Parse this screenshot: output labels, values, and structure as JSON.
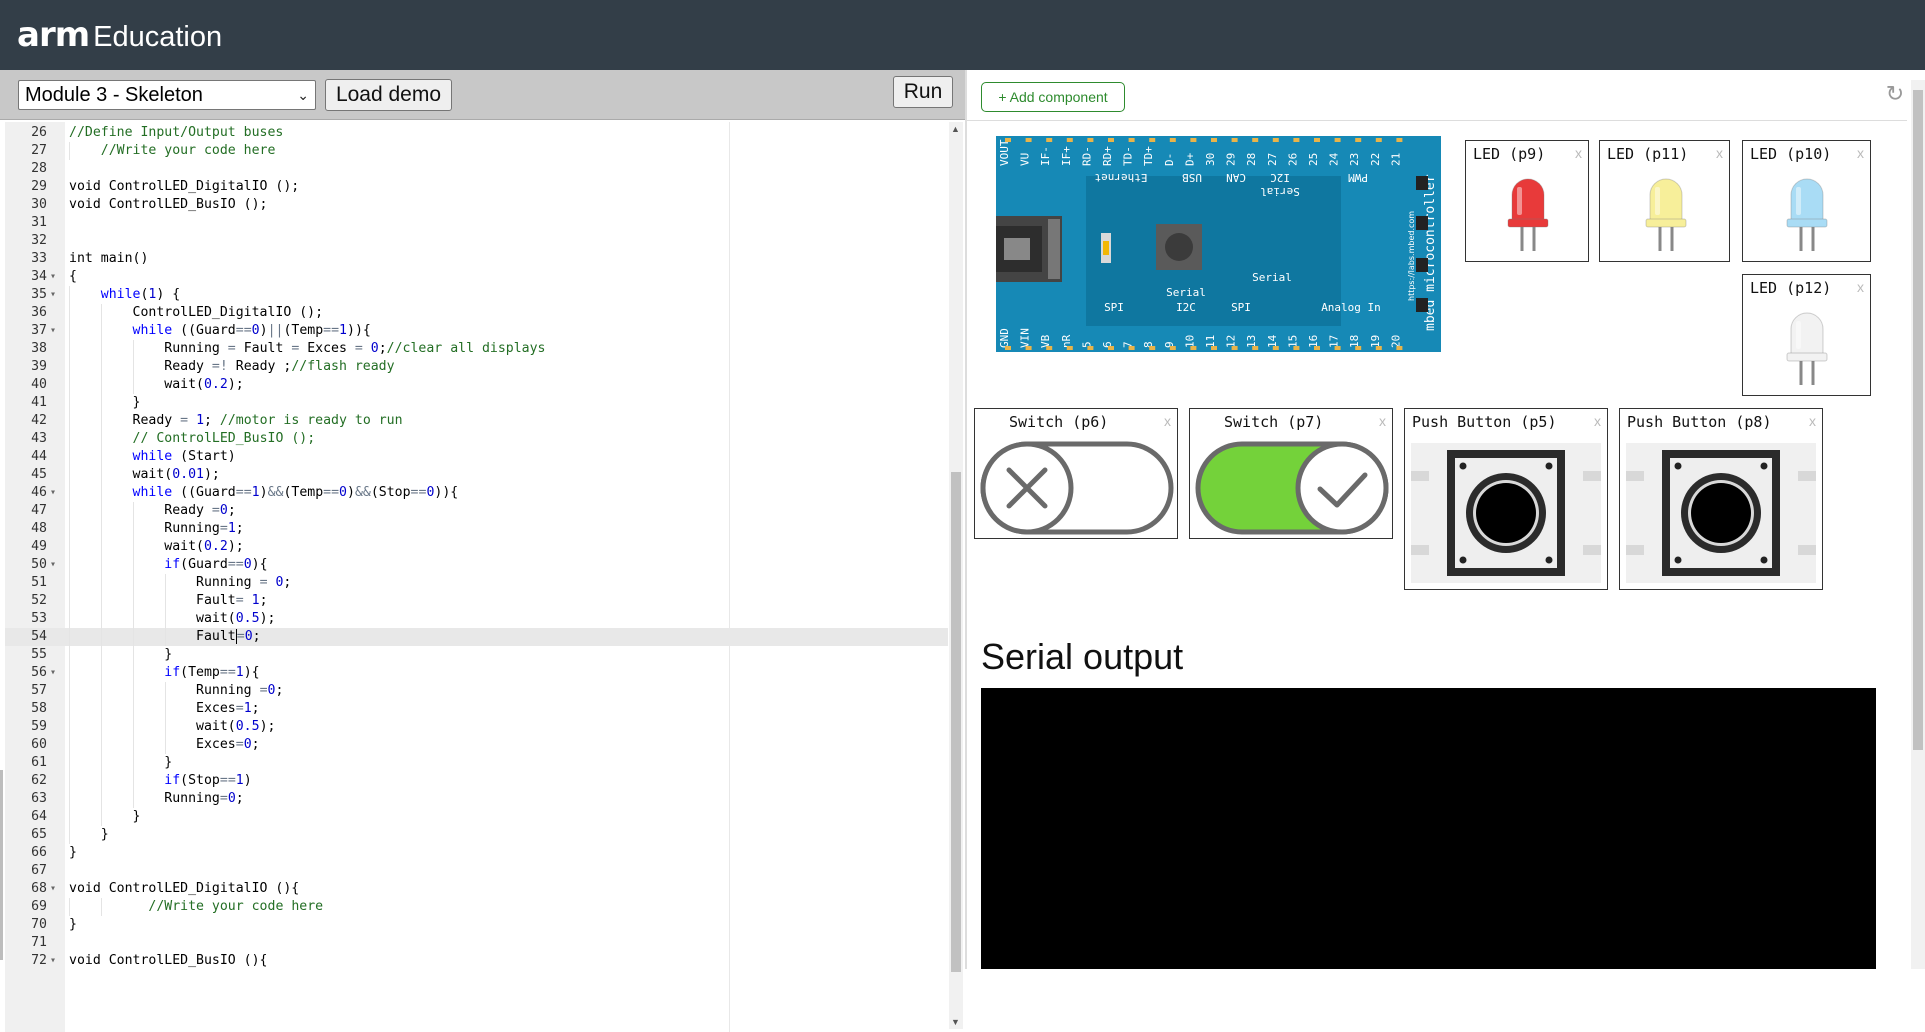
{
  "header": {
    "logo_bold": "arm",
    "logo_text": "Education"
  },
  "toolbar": {
    "module_selected": "Module 3 - Skeleton",
    "load_demo_label": "Load demo",
    "run_label": "Run"
  },
  "editor": {
    "active_line": 54,
    "lines": [
      {
        "n": 26,
        "fold": false,
        "html": "<span class='cmt'>//Define Input/Output buses</span>"
      },
      {
        "n": 27,
        "fold": false,
        "html": "    <span class='cmt'>//Write your code here</span>"
      },
      {
        "n": 28,
        "fold": false,
        "html": ""
      },
      {
        "n": 29,
        "fold": false,
        "html": "void ControlLED_DigitalIO ();"
      },
      {
        "n": 30,
        "fold": false,
        "html": "void ControlLED_BusIO ();"
      },
      {
        "n": 31,
        "fold": false,
        "html": ""
      },
      {
        "n": 32,
        "fold": false,
        "html": ""
      },
      {
        "n": 33,
        "fold": false,
        "html": "int main()"
      },
      {
        "n": 34,
        "fold": true,
        "html": "{"
      },
      {
        "n": 35,
        "fold": true,
        "html": "    <span class='kw'>while</span>(<span class='num'>1</span>) {"
      },
      {
        "n": 36,
        "fold": false,
        "html": "        ControlLED_DigitalIO ();"
      },
      {
        "n": 37,
        "fold": true,
        "html": "        <span class='kw'>while</span> ((Guard<span class='op'>==</span><span class='num'>0</span>)<span class='op'>||</span>(Temp<span class='op'>==</span><span class='num'>1</span>)){"
      },
      {
        "n": 38,
        "fold": false,
        "html": "            Running <span class='op'>=</span> Fault <span class='op'>=</span> Exces <span class='op'>=</span> <span class='num'>0</span>;<span class='cmt'>//clear all displays</span>"
      },
      {
        "n": 39,
        "fold": false,
        "html": "            Ready <span class='op'>=!</span> Ready ;<span class='cmt'>//flash ready</span>"
      },
      {
        "n": 40,
        "fold": false,
        "html": "            wait(<span class='num'>0.2</span>);"
      },
      {
        "n": 41,
        "fold": false,
        "html": "        }"
      },
      {
        "n": 42,
        "fold": false,
        "html": "        Ready <span class='op'>=</span> <span class='num'>1</span>; <span class='cmt'>//motor is ready to run</span>"
      },
      {
        "n": 43,
        "fold": false,
        "html": "        <span class='cmt'>// ControlLED_BusIO ();</span>"
      },
      {
        "n": 44,
        "fold": false,
        "html": "        <span class='kw'>while</span> (Start)"
      },
      {
        "n": 45,
        "fold": false,
        "html": "        wait(<span class='num'>0.01</span>);"
      },
      {
        "n": 46,
        "fold": true,
        "html": "        <span class='kw'>while</span> ((Guard<span class='op'>==</span><span class='num'>1</span>)<span class='op'>&amp;&amp;</span>(Temp<span class='op'>==</span><span class='num'>0</span>)<span class='op'>&amp;&amp;</span>(Stop<span class='op'>==</span><span class='num'>0</span>)){"
      },
      {
        "n": 47,
        "fold": false,
        "html": "            Ready <span class='op'>=</span><span class='num'>0</span>;"
      },
      {
        "n": 48,
        "fold": false,
        "html": "            Running<span class='op'>=</span><span class='num'>1</span>;"
      },
      {
        "n": 49,
        "fold": false,
        "html": "            wait(<span class='num'>0.2</span>);"
      },
      {
        "n": 50,
        "fold": true,
        "html": "            <span class='kw'>if</span>(Guard<span class='op'>==</span><span class='num'>0</span>){"
      },
      {
        "n": 51,
        "fold": false,
        "html": "                Running <span class='op'>=</span> <span class='num'>0</span>;"
      },
      {
        "n": 52,
        "fold": false,
        "html": "                Fault<span class='op'>=</span> <span class='num'>1</span>;"
      },
      {
        "n": 53,
        "fold": false,
        "html": "                wait(<span class='num'>0.5</span>);"
      },
      {
        "n": 54,
        "fold": false,
        "html": "                Fault<span class='cursor'></span><span class='op'>=</span><span class='num'>0</span>;"
      },
      {
        "n": 55,
        "fold": false,
        "html": "            }"
      },
      {
        "n": 56,
        "fold": true,
        "html": "            <span class='kw'>if</span>(Temp<span class='op'>==</span><span class='num'>1</span>){"
      },
      {
        "n": 57,
        "fold": false,
        "html": "                Running <span class='op'>=</span><span class='num'>0</span>;"
      },
      {
        "n": 58,
        "fold": false,
        "html": "                Exces<span class='op'>=</span><span class='num'>1</span>;"
      },
      {
        "n": 59,
        "fold": false,
        "html": "                wait(<span class='num'>0.5</span>);"
      },
      {
        "n": 60,
        "fold": false,
        "html": "                Exces<span class='op'>=</span><span class='num'>0</span>;"
      },
      {
        "n": 61,
        "fold": false,
        "html": "            }"
      },
      {
        "n": 62,
        "fold": false,
        "html": "            <span class='kw'>if</span>(Stop<span class='op'>==</span><span class='num'>1</span>)"
      },
      {
        "n": 63,
        "fold": false,
        "html": "            Running<span class='op'>=</span><span class='num'>0</span>;"
      },
      {
        "n": 64,
        "fold": false,
        "html": "        }"
      },
      {
        "n": 65,
        "fold": false,
        "html": "    }"
      },
      {
        "n": 66,
        "fold": false,
        "html": "}"
      },
      {
        "n": 67,
        "fold": false,
        "html": ""
      },
      {
        "n": 68,
        "fold": true,
        "html": "void ControlLED_DigitalIO (){"
      },
      {
        "n": 69,
        "fold": false,
        "html": "          <span class='cmt'>//Write your code here</span>"
      },
      {
        "n": 70,
        "fold": false,
        "html": "}"
      },
      {
        "n": 71,
        "fold": false,
        "html": ""
      },
      {
        "n": 72,
        "fold": true,
        "html": "void ControlLED_BusIO (){"
      }
    ]
  },
  "right": {
    "add_component_label": "+ Add component",
    "refresh_icon": "refresh-icon",
    "board": {
      "top_pins": [
        "VOUT",
        "VU",
        "IF-",
        "IF+",
        "RD-",
        "RD+",
        "TD-",
        "TD+",
        "D-",
        "D+",
        "30",
        "29",
        "28",
        "27",
        "26",
        "25",
        "24",
        "23",
        "22",
        "21"
      ],
      "top_groups": [
        "Ethernet",
        "USB",
        "CAN",
        "I2C",
        "PWM"
      ],
      "serial_labels": [
        "Serial",
        "Serial"
      ],
      "bottom_pins": [
        "GND",
        "VIN",
        "VB",
        "nR",
        "5",
        "6",
        "7",
        "8",
        "9",
        "10",
        "11",
        "12",
        "13",
        "14",
        "15",
        "16",
        "17",
        "18",
        "19",
        "20"
      ],
      "bottom_groups": [
        "SPI",
        "I2C",
        "SPI",
        "Analog In"
      ],
      "side_text": "mbed microcontroller",
      "url_text": "https://labs.mbed.com"
    },
    "components": {
      "led_p9": {
        "title": "LED (p9)",
        "color": "#e83a3a",
        "close": "x"
      },
      "led_p11": {
        "title": "LED (p11)",
        "color": "#f7ef9a",
        "close": "x"
      },
      "led_p10": {
        "title": "LED (p10)",
        "color": "#a9dcf5",
        "close": "x"
      },
      "led_p12": {
        "title": "LED (p12)",
        "color": "#f2f2f2",
        "close": "x"
      },
      "switch_p6": {
        "title": "Switch (p6)",
        "state": "off",
        "close": "x"
      },
      "switch_p7": {
        "title": "Switch (p7)",
        "state": "on",
        "accent": "#74d23a",
        "close": "x"
      },
      "button_p5": {
        "title": "Push Button (p5)",
        "close": "x"
      },
      "button_p8": {
        "title": "Push Button (p8)",
        "close": "x"
      }
    },
    "serial": {
      "title": "Serial output",
      "text": ""
    }
  }
}
